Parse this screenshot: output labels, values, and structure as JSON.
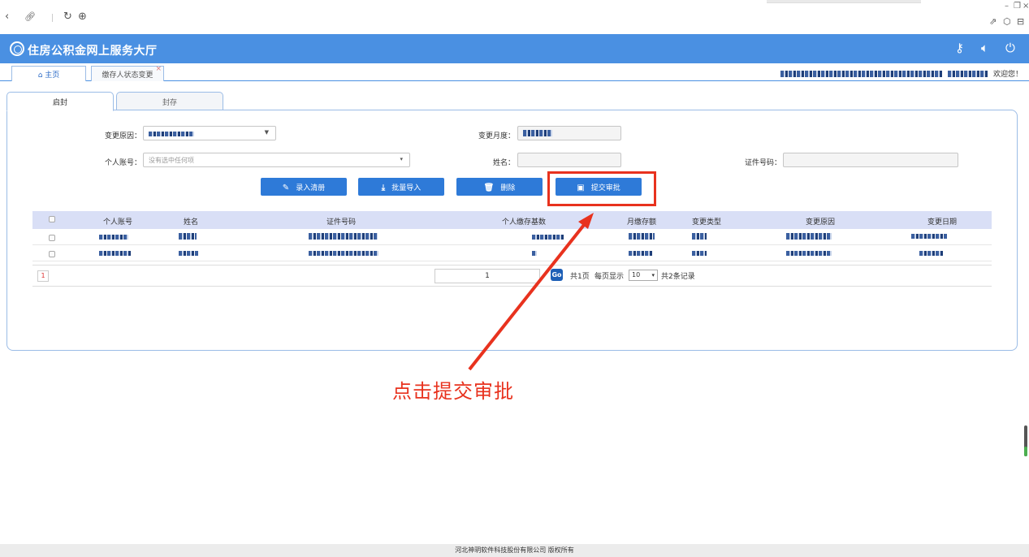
{
  "browser": {
    "back_icon": "chevron-left-icon",
    "link_icon": "link-icon",
    "refresh_icon": "refresh-icon",
    "globe_icon": "globe-icon",
    "window_controls": [
      "–",
      "❐",
      "×"
    ]
  },
  "header": {
    "title": "住房公积金网上服务大厅",
    "icons": [
      "key-icon",
      "speaker-icon",
      "power-icon"
    ]
  },
  "tabs": {
    "home_label": "主页",
    "current_label": "缴存人状态变更",
    "close_mark": "×"
  },
  "user": {
    "welcome": "欢迎您！"
  },
  "panel_tabs": {
    "unseal": "启封",
    "seal": "封存"
  },
  "form": {
    "reason_label": "变更原因：",
    "month_label": "变更月度：",
    "account_label": "个人账号：",
    "account_placeholder": "没有选中任何项",
    "name_label": "姓名：",
    "id_label": "证件号码："
  },
  "buttons": {
    "add": "录入清册",
    "batch": "批量导入",
    "delete": "删除",
    "submit": "提交审批"
  },
  "table": {
    "columns": [
      "个人账号",
      "姓名",
      "证件号码",
      "个人缴存基数",
      "月缴存额",
      "变更类型",
      "变更原因",
      "变更日期"
    ]
  },
  "pager": {
    "current_page": "1",
    "page_input": "1",
    "go": "Go",
    "total_pages": "共1页",
    "per_page_label": "每页显示",
    "per_page": "10",
    "records": "共2条记录"
  },
  "annotation": "点击提交审批",
  "footer": "河北神玥软件科技股份有限公司 版权所有",
  "colors": {
    "header": "#4a90e2",
    "button": "#2e7ad8",
    "highlight": "#e8321e",
    "table_header": "#d9dff6"
  }
}
